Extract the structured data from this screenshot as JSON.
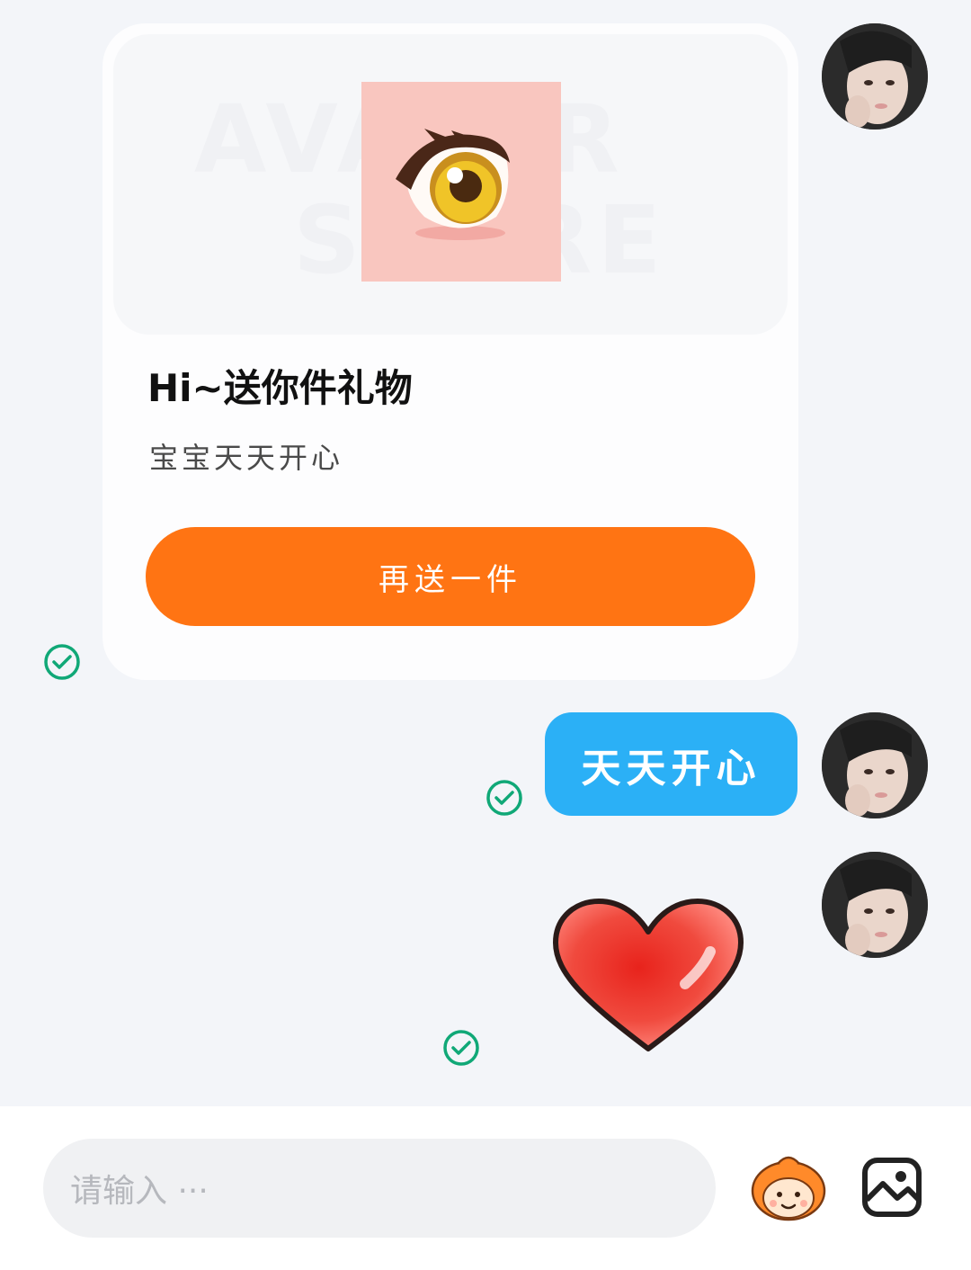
{
  "gift_card": {
    "title": "Hi~送你件礼物",
    "subtitle": "宝宝天天开心",
    "button_label": "再送一件",
    "watermark_line1": "AVATAR",
    "watermark_line2": "STORE"
  },
  "messages": [
    {
      "type": "text",
      "text": "天天开心",
      "status": "sent"
    },
    {
      "type": "sticker",
      "sticker": "red-heart",
      "status": "sent"
    }
  ],
  "input": {
    "placeholder": "请输入 ···"
  },
  "icons": {
    "emoji": "emoji-mascot-icon",
    "image": "image-icon",
    "status": "check-circle-icon"
  },
  "colors": {
    "accent_orange": "#ff7413",
    "bubble_blue": "#2bb0f6",
    "status_green": "#10a877"
  }
}
